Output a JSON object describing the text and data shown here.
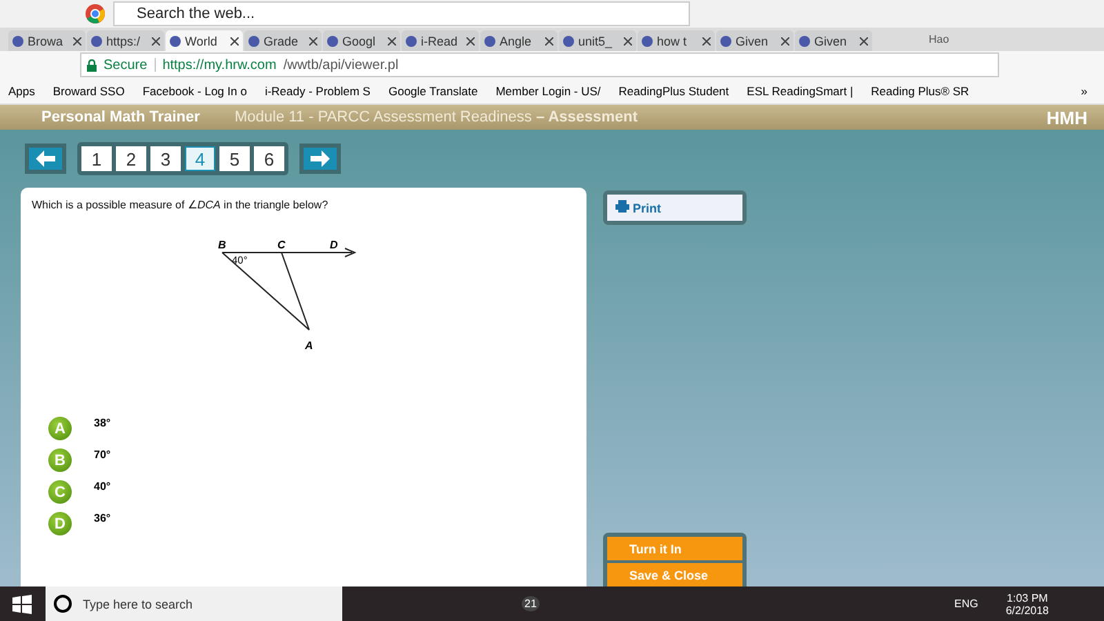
{
  "browser": {
    "search_placeholder": "Search the web...",
    "profile": "Hao",
    "tabs": [
      {
        "label": "Browa",
        "selected": false
      },
      {
        "label": "https:/",
        "selected": false
      },
      {
        "label": "World",
        "selected": true
      },
      {
        "label": "Grade",
        "selected": false
      },
      {
        "label": "Googl",
        "selected": false
      },
      {
        "label": "i-Read",
        "selected": false
      },
      {
        "label": "Angle",
        "selected": false
      },
      {
        "label": "unit5_",
        "selected": false
      },
      {
        "label": "how t",
        "selected": false
      },
      {
        "label": "Given",
        "selected": false
      },
      {
        "label": "Given",
        "selected": false
      }
    ],
    "secure": "Secure",
    "url_host": "https://my.hrw.com",
    "url_path": "/wwtb/api/viewer.pl",
    "bookmarks": [
      "Apps",
      "Broward SSO",
      "Facebook - Log In o",
      "i-Ready - Problem S",
      "Google Translate",
      "Member Login - US/",
      "ReadingPlus Student",
      "ESL ReadingSmart |",
      "Reading Plus® SR"
    ],
    "more": "»"
  },
  "app": {
    "brand": "Personal Math Trainer",
    "module": "Module 11 - PARCC Assessment Readiness",
    "separator": "–",
    "section": "Assessment",
    "publisher": "HMH",
    "questions": [
      {
        "label": "1",
        "selected": false
      },
      {
        "label": "2",
        "selected": false
      },
      {
        "label": "3",
        "selected": false
      },
      {
        "label": "4",
        "selected": true
      },
      {
        "label": "5",
        "selected": false
      },
      {
        "label": "6",
        "selected": false
      }
    ],
    "prompt": "Which is a possible measure of ∠*DCA*  in the triangle below?",
    "figure": {
      "point_b": "B",
      "point_c": "C",
      "point_d": "D",
      "point_a": "A",
      "angle": "40°"
    },
    "answers": [
      {
        "letter": "A",
        "text": "38°"
      },
      {
        "letter": "B",
        "text": "70°"
      },
      {
        "letter": "C",
        "text": "40°"
      },
      {
        "letter": "D",
        "text": "36°"
      }
    ],
    "print": "Print",
    "turn_in": "Turn it In",
    "save_close": "Save & Close"
  },
  "taskbar": {
    "search_placeholder": "Type here to search",
    "mail_count": "21",
    "lang": "ENG",
    "time": "1:03 PM",
    "date": "6/2/2018"
  }
}
